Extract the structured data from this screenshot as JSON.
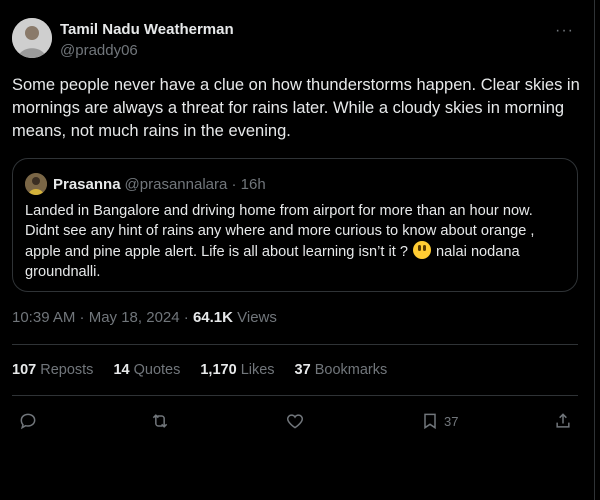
{
  "author": {
    "display_name": "Tamil Nadu Weatherman",
    "handle": "@praddy06",
    "avatar_icon": "person-avatar-icon"
  },
  "more_icon_text": "···",
  "tweet": {
    "text": "Some people never have a clue on how thunderstorms happen. Clear skies in mornings are always a threat for rains later. While a cloudy skies in morning means, not much rains in the evening."
  },
  "quote": {
    "display_name": "Prasanna",
    "handle_time": "@prasannalara · 16h",
    "text_before_emoji": "Landed in Bangalore and driving home from airport for more than an hour now. Didnt see any hint of rains any where and more curious to know about orange , apple and pine apple alert. Life is all about learning isn’t it ?",
    "text_after_emoji": " nalai nodana groundnalli."
  },
  "meta": {
    "timestamp": "10:39 AM · May 18, 2024 · ",
    "views_count": "64.1K",
    "views_label": " Views"
  },
  "stats": {
    "reposts": {
      "count": "107",
      "label": "Reposts"
    },
    "quotes": {
      "count": "14",
      "label": "Quotes"
    },
    "likes": {
      "count": "1,170",
      "label": "Likes"
    },
    "bookmarks": {
      "count": "37",
      "label": "Bookmarks"
    }
  },
  "actions": {
    "bookmark_count": "37"
  },
  "colors": {
    "background": "#000000",
    "text_primary": "#e7e9ea",
    "text_secondary": "#71767b",
    "border": "#2f3336"
  }
}
